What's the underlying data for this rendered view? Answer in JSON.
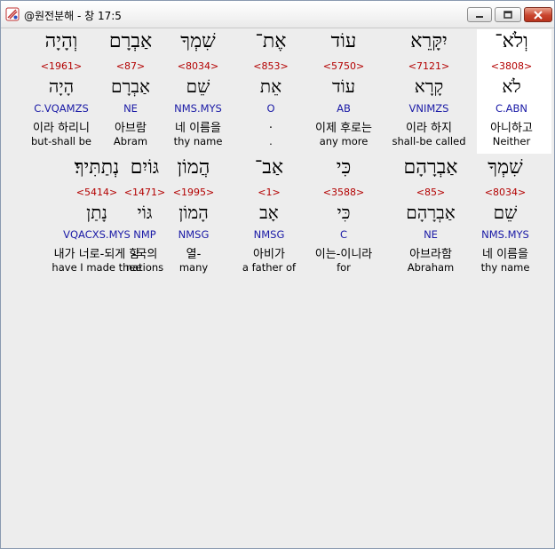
{
  "window": {
    "title": "@원전분해 - 창 17:5",
    "controls": {
      "minimize": "minimize-icon",
      "maximize": "maximize-icon",
      "close": "close-icon"
    },
    "close_color": "#c9452d"
  },
  "colors": {
    "strongs": "#b30000",
    "parse": "#1a1aa6",
    "highlight_bg": "#ffffff"
  },
  "rows": [
    {
      "words": [
        {
          "hebrew": "וְלֹא־",
          "strongs": "<3808>",
          "root": "לֹא",
          "parse": "C.ABN",
          "korean": "아니하고",
          "english": "Neither"
        },
        {
          "hebrew": "יִקָּרֵא",
          "strongs": "<7121>",
          "root": "קָרָא",
          "parse": "VNIMZS",
          "korean": "이라 하지",
          "english": "shall-be called"
        },
        {
          "hebrew": "עוֹד",
          "strongs": "<5750>",
          "root": "עוֹד",
          "parse": "AB",
          "korean": "이제 후로는",
          "english": "any more"
        },
        {
          "hebrew": "אֶת־",
          "strongs": "<853>",
          "root": "אֵת",
          "parse": "O",
          "korean": ".",
          "english": "."
        },
        {
          "hebrew": "שִׁמְךָ",
          "strongs": "<8034>",
          "root": "שֵׁם",
          "parse": "NMS.MYS",
          "korean": "네 이름을",
          "english": "thy name"
        },
        {
          "hebrew": "אַבְרָם",
          "strongs": "<87>",
          "root": "אַבְרָם",
          "parse": "NE",
          "korean": "아브람",
          "english": "Abram"
        },
        {
          "hebrew": "וְהָיָה",
          "strongs": "<1961>",
          "root": "הָיָה",
          "parse": "C.VQAMZS",
          "korean": "이라 하리니",
          "english": "but-shall be"
        }
      ]
    },
    {
      "words": [
        {
          "hebrew": "שִׁמְךָ",
          "strongs": "<8034>",
          "root": "שֵׁם",
          "parse": "NMS.MYS",
          "korean": "네 이름을",
          "english": "thy name"
        },
        {
          "hebrew": "אַבְרָהָם",
          "strongs": "<85>",
          "root": "אַבְרָהָם",
          "parse": "NE",
          "korean": "아브라함",
          "english": "Abraham"
        },
        {
          "hebrew": "כִּי",
          "strongs": "<3588>",
          "root": "כִּי",
          "parse": "C",
          "korean": "이는-이니라",
          "english": "for"
        },
        {
          "hebrew": "אַב־",
          "strongs": "<1>",
          "root": "אָב",
          "parse": "NMSG",
          "korean": "아비가",
          "english": "a father of"
        },
        {
          "hebrew": "הֲמוֹן",
          "strongs": "<1995>",
          "root": "הָמוֹן",
          "parse": "NMSG",
          "korean": "열-",
          "english": "many"
        },
        {
          "hebrew": "גּוֹיִם",
          "strongs": "<1471>",
          "root": "גּוֹי",
          "parse": "NMP",
          "korean": "-국의",
          "english": "nations"
        },
        {
          "hebrew": "נְתַתִּיךָ׃",
          "strongs": "<5414>",
          "root": "נָתַן",
          "parse": "VQACXS.MYS",
          "korean": "내가 너로-되게 함",
          "english": "have I made thee"
        }
      ]
    }
  ]
}
